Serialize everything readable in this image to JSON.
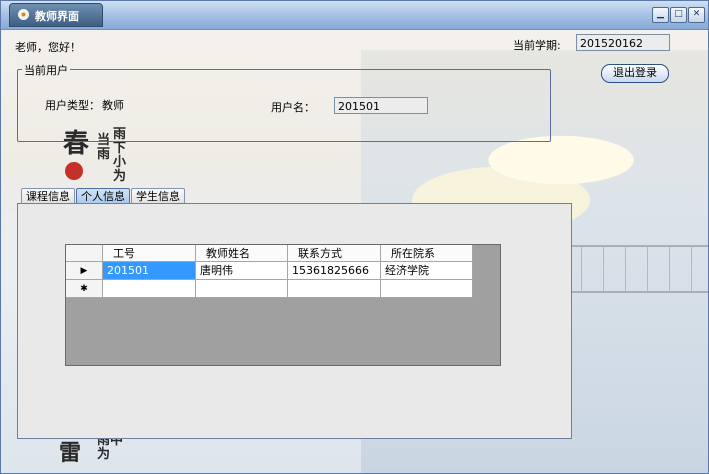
{
  "window": {
    "title": "教师界面",
    "buttons": [
      "minimize",
      "maximize",
      "close"
    ]
  },
  "greeting": "老师，您好！",
  "semester": {
    "label": "当前学期:",
    "value": "201520162"
  },
  "logout_label": "退出登录",
  "current_user": {
    "group_title": "当前用户",
    "type_label": "用户类型：",
    "type_value": "教师",
    "name_label": "用户名：",
    "name_value": "201501"
  },
  "tabs": [
    {
      "label": "课程信息",
      "active": false
    },
    {
      "label": "个人信息",
      "active": true
    },
    {
      "label": "学生信息",
      "active": false
    }
  ],
  "grid": {
    "columns": [
      "工号",
      "教师姓名",
      "联系方式",
      "所在院系"
    ],
    "rows": [
      [
        "201501",
        "唐明伟",
        "15361825666",
        "经济学院"
      ]
    ],
    "new_row_marker": "✱",
    "current_row_marker": "▶"
  },
  "background_text": {
    "top": [
      "当",
      "雨",
      "下",
      "小",
      "雨",
      "春",
      "为"
    ],
    "bottom": [
      "雨中",
      "为",
      "雷"
    ]
  },
  "colors": {
    "title_bar": "#a9c4e6",
    "selection": "#3399ff",
    "grid_background": "#a0a0a0"
  },
  "icons": {
    "app": "flower-icon",
    "minimize": "minimize-icon",
    "maximize": "maximize-icon",
    "close": "close-icon"
  }
}
